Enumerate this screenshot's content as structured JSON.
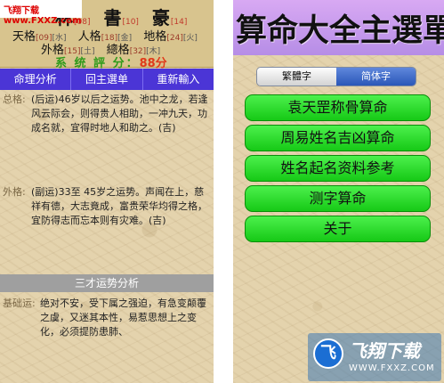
{
  "watermark": "飞翔下载 www.FXXZ.com",
  "left": {
    "name_chars": [
      {
        "char": "林",
        "num": "[08]"
      },
      {
        "char": "書",
        "num": "[10]"
      },
      {
        "char": "豪",
        "num": "[14]"
      }
    ],
    "ge_row1": [
      {
        "label": "天格",
        "num": "[09]",
        "wx": "[水]"
      },
      {
        "label": "人格",
        "num": "[18]",
        "wx": "[金]"
      },
      {
        "label": "地格",
        "num": "[24]",
        "wx": "[火]"
      }
    ],
    "ge_row2": [
      {
        "label": "外格",
        "num": "[15]",
        "wx": "[土]"
      },
      {
        "label": "總格",
        "num": "[32]",
        "wx": "[木]"
      }
    ],
    "score_label": "系 统 評 分：",
    "score_value": "88分",
    "tabs": [
      "命理分析",
      "回主選单",
      "重新輸入"
    ],
    "para1_label": "总格:",
    "para1_text": "(后运)46岁以后之运势。池中之龙，若逢风云际会，则得贵人相助，一冲九天，功成名就，宜得时地人和助之。(吉)",
    "para2_label": "外格:",
    "para2_text": "(副运)33至 45岁之运势。声闻在上，慈祥有德，大志竟成，富贵荣华均得之格，宜防得志而忘本则有灾难。(吉)",
    "section_title": "三才运势分析",
    "para3_label": "基础运:",
    "para3_text": "绝对不安，受下属之强迫，有急变颠覆之虞，又迷其本性，易惹思想上之变化，必须提防患肺、"
  },
  "right": {
    "title": "算命大全主選單",
    "seg_trad": "繁體字",
    "seg_simp": "简体字",
    "menu": [
      "袁天罡称骨算命",
      "周易姓名吉凶算命",
      "姓名起名资料参考",
      "测字算命",
      "关于"
    ]
  },
  "logo": {
    "mark": "飞",
    "brand": "飞翔下载",
    "url": "WWW.FXXZ.COM"
  },
  "colors": {
    "tab_bar": "#4b35d6",
    "menu_green": "#22d022",
    "banner_purple": "#c79cee",
    "score_green": "#2e9a1a",
    "score_red": "#e03a1a"
  }
}
